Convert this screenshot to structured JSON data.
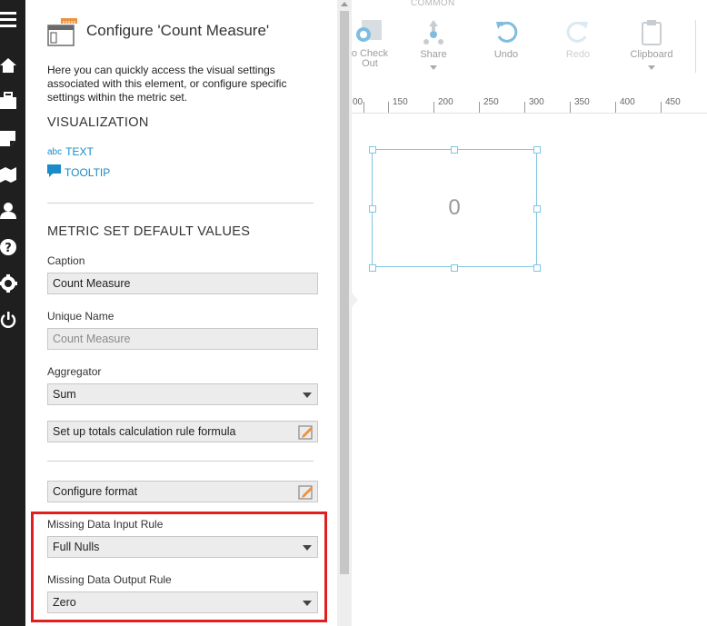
{
  "rail": {
    "icons": [
      "menu-icon",
      "home-icon",
      "briefcase-icon",
      "note-icon",
      "map-icon",
      "user-icon",
      "help-icon",
      "gear-icon",
      "power-icon"
    ]
  },
  "panel": {
    "title": "Configure 'Count Measure'",
    "description": "Here you can quickly access the visual settings associated with this element, or configure specific settings within the metric set.",
    "visualization_heading": "VISUALIZATION",
    "text_link_prefix": "abc",
    "text_link": "TEXT",
    "tooltip_link": "TOOLTIP",
    "defaults_heading": "METRIC SET DEFAULT VALUES",
    "caption_label": "Caption",
    "caption_value": "Count Measure",
    "unique_name_label": "Unique Name",
    "unique_name_value": "Count Measure",
    "aggregator_label": "Aggregator",
    "aggregator_value": "Sum",
    "totals_button": "Set up totals calculation rule formula",
    "format_button": "Configure format",
    "missing_input_label": "Missing Data Input Rule",
    "missing_input_value": "Full Nulls",
    "missing_output_label": "Missing Data Output Rule",
    "missing_output_value": "Zero"
  },
  "toolbar": {
    "group_label": "COMMON",
    "checkout_line1": "o Check",
    "checkout_line2": "Out",
    "share": "Share",
    "undo": "Undo",
    "redo": "Redo",
    "clipboard": "Clipboard"
  },
  "ruler": {
    "labels": [
      "00",
      "150",
      "200",
      "250",
      "300",
      "350",
      "400",
      "450"
    ]
  },
  "widget": {
    "value": "0"
  },
  "colors": {
    "accent": "#1a8bc8",
    "highlight": "#e02020",
    "rail": "#1f1f1f",
    "selection": "#7fc6e4"
  }
}
